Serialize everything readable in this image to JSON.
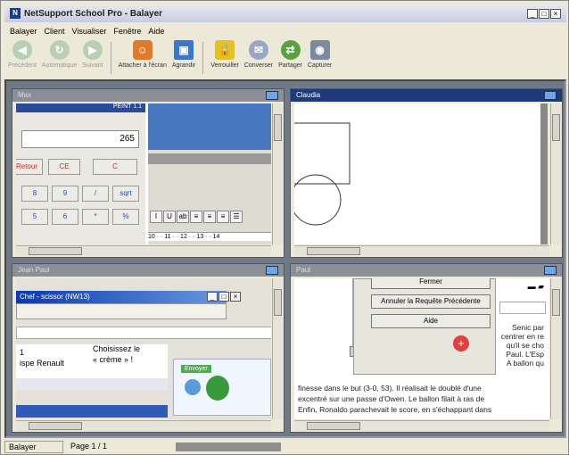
{
  "window": {
    "title": "NetSupport School Pro - Balayer",
    "app_icon": "N"
  },
  "window_buttons": [
    "_",
    "□",
    "×"
  ],
  "menu": [
    "Balayer",
    "Client",
    "Visualiser",
    "Fenêtre",
    "Aide"
  ],
  "toolbar": [
    {
      "label": "Précédent",
      "icon": "arrow-left-icon",
      "enabled": false
    },
    {
      "label": "Automatique",
      "icon": "auto-icon",
      "enabled": false
    },
    {
      "label": "Suivant",
      "icon": "arrow-right-icon",
      "enabled": false
    },
    {
      "label": "Attacher à l'écran",
      "icon": "attach-screen-icon",
      "enabled": true
    },
    {
      "label": "Agrandir",
      "icon": "enlarge-icon",
      "enabled": true
    },
    {
      "label": "Verrouiller",
      "icon": "lock-icon",
      "enabled": true
    },
    {
      "label": "Converser",
      "icon": "chat-icon",
      "enabled": true
    },
    {
      "label": "Partager",
      "icon": "share-icon",
      "enabled": true
    },
    {
      "label": "Capturer",
      "icon": "camera-icon",
      "enabled": true
    }
  ],
  "panes": {
    "top_left": {
      "title": "Max"
    },
    "top_right": {
      "title": "Claudia"
    },
    "bottom_left": {
      "title": "Jean Paul"
    },
    "bottom_right": {
      "title": "Paul"
    }
  },
  "calc": {
    "title": "PEINT 1.1",
    "display": "265",
    "keys_row1": [
      "Retour",
      "CE",
      "C"
    ],
    "keys": [
      "8",
      "9",
      "/",
      "sqrt",
      "5",
      "6",
      "*",
      "%"
    ]
  },
  "word_format": [
    "I",
    "U",
    "ab",
    "≡",
    "≡",
    "≡",
    "☰"
  ],
  "word_ruler": "10 · · 11 · · 12 · · 13 · · 14",
  "jean_paul": {
    "dialog_title": "Chef - scissor (NW13)",
    "list_left": [
      "1",
      "ispe Renault"
    ],
    "list_right": [
      "Choisissez le",
      "« crème » !"
    ],
    "banner": "Envoyer"
  },
  "paul": {
    "button_top": "Fermer",
    "button_undo": "Annuler la Requête Précédente",
    "button_help": "Aide",
    "right_text": [
      "Senic par",
      "centrer en re",
      "qu'il se cho",
      "Paul. L'Esp",
      "A ballon qu"
    ],
    "article": [
      "finesse dans le but (3-0, 53). Il réalisait le doublé d'une",
      "excentré sur une passe d'Owen. Le ballon filait à ras de",
      "Enfin, Ronaldo parachevait le score, en s'échappant dans"
    ]
  },
  "status": {
    "left": "Balayer",
    "page": "Page 1 / 1"
  }
}
